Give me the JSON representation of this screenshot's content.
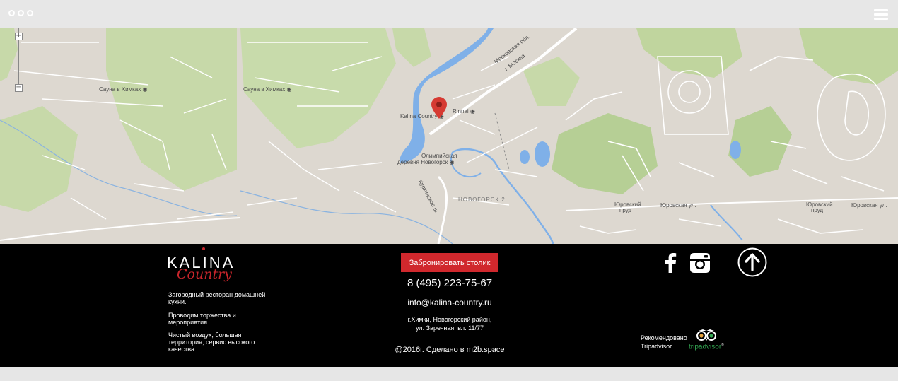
{
  "window": {
    "menu_icon": "hamburger-menu-icon"
  },
  "map": {
    "places": [
      {
        "name": "Сауна в Химках",
        "icon": "poi-marker-icon"
      },
      {
        "name": "Сауна в Химках",
        "icon": "poi-marker-icon"
      },
      {
        "name": "Kalina Country",
        "icon": "poi-marker-icon"
      },
      {
        "name": "Rinnai",
        "icon": "poi-marker-icon"
      },
      {
        "name": "Олимпийская",
        "icon": "poi-marker-icon"
      },
      {
        "name": "деревня Новогорск",
        "icon": ""
      },
      {
        "name": "НОВОГОРСК 2",
        "icon": ""
      },
      {
        "name": "Юровский",
        "icon": ""
      },
      {
        "name": "пруд",
        "icon": ""
      },
      {
        "name": "Юровская ул.",
        "icon": ""
      },
      {
        "name": "Юровский",
        "icon": ""
      },
      {
        "name": "пруд",
        "icon": ""
      },
      {
        "name": "Юровская ул.",
        "icon": ""
      }
    ],
    "roads": [
      "Московская обл.",
      "г. Москва",
      "Куркинское ш."
    ],
    "zoom_in": "+",
    "zoom_out": "−",
    "colors": {
      "water": "#7fb0e8",
      "park": "#c7d9a9",
      "land": "#ddd8d0",
      "road": "#ffffff",
      "pin": "#d63a32"
    }
  },
  "footer": {
    "logo": {
      "brand": "KALINA",
      "script": "Country"
    },
    "taglines": [
      "Загородный ресторан домашней кухни.",
      "Проводим торжества и мероприятия",
      "Чистый воздух, большая территория, сервис высокого качества"
    ],
    "book_button": "Забронировать столик",
    "phone": "8 (495) 223-75-67",
    "email": "info@kalina-country.ru",
    "address_line1": "г.Химки, Новогорский район,",
    "address_line2": "ул. Заречная, вл. 11/77",
    "copyright": "@2016г. Сделано в m2b.space",
    "social": [
      "facebook-icon",
      "instagram-icon"
    ],
    "scroll_top_icon": "arrow-up-circle-icon",
    "recommend_line1": "Рекомендовано",
    "recommend_line2": "Tripadvisor",
    "tripadvisor": {
      "trip": "trip",
      "advisor": "advisor",
      "mark": "®"
    },
    "colors": {
      "accent": "#d0282d",
      "background": "#000000"
    }
  }
}
